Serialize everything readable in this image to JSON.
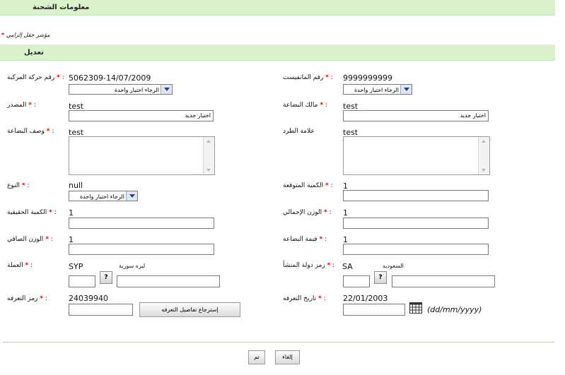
{
  "header": {
    "title": "معلومات الشحنة"
  },
  "mandatory_note": "مؤشر حقل إلزامي",
  "section": {
    "title": "تعديل"
  },
  "required_mark": "*",
  "fields": {
    "manifest_no": {
      "label": "رقم المانفيست",
      "value": "9999999999",
      "select": "الرجاء اختيار واحدة"
    },
    "movement_no": {
      "label": "رقم حركة المركبة",
      "value": "5062309-14/07/2009",
      "select": "الرجاء اختيار واحدة"
    },
    "goods_owner": {
      "label": "مالك البضاعة",
      "value": "test",
      "button": "اختيار جديد"
    },
    "exporter": {
      "label": "المصدر",
      "value": "test",
      "button": "اختيار جديد"
    },
    "package_mark": {
      "label": "علامة الطرد",
      "value": "test"
    },
    "goods_desc": {
      "label": "وصف البضاعة",
      "value": "test"
    },
    "expected_qty": {
      "label": "الكمية المتوقعة",
      "value": "1"
    },
    "type": {
      "label": "النوع",
      "value": "null",
      "select": "الرجاء اختيار واحدة"
    },
    "gross_weight": {
      "label": "الوزن الإجمالي",
      "value": "1"
    },
    "actual_qty": {
      "label": "الكمية الحقيقية",
      "value": "1"
    },
    "goods_value": {
      "label": "قيمة البضاعة",
      "value": "1"
    },
    "net_weight": {
      "label": "الوزن الصافي",
      "value": "1"
    },
    "origin_country": {
      "label": "رمز دولة المنشأ",
      "value": "SA",
      "name": "السعوديه",
      "help": "?"
    },
    "currency": {
      "label": "العملة",
      "value": "SYP",
      "name": "ليره سورية",
      "help": "?"
    },
    "tariff_date": {
      "label": "تاريخ التعرفه",
      "value": "22/01/2003",
      "format": "(dd/mm/yyyy)"
    },
    "tariff_code": {
      "label": "رمز التعرفه",
      "value": "24039940",
      "button": "إسترجاع تفاصيل التعرفه"
    }
  },
  "footer": {
    "cancel": "إلغاء",
    "ok": "تم"
  }
}
